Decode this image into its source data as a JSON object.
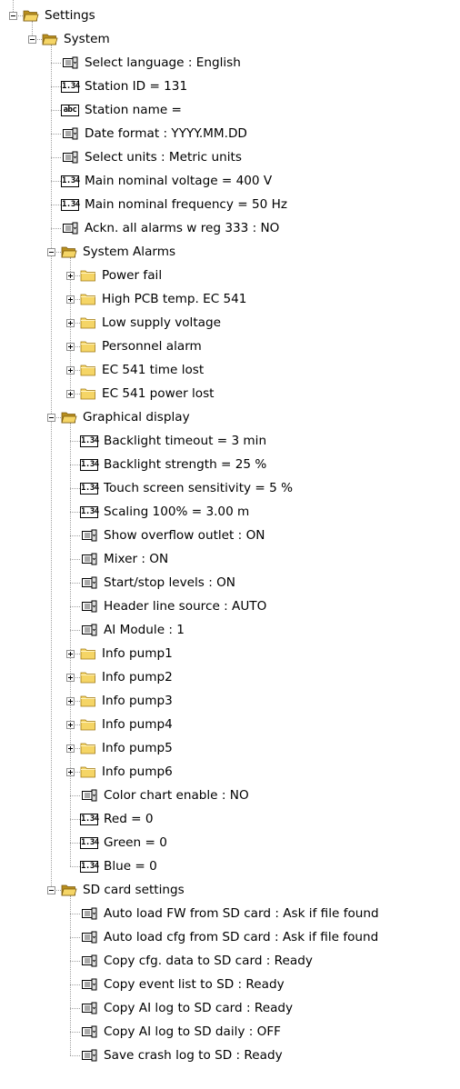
{
  "tree": [
    {
      "level": 0,
      "type": "folder-open",
      "expander": "minus",
      "label": "Settings",
      "icon": "open-folder-icon"
    },
    {
      "level": 1,
      "type": "folder-open",
      "expander": "minus",
      "label": "System",
      "icon": "open-folder-icon"
    },
    {
      "level": 2,
      "type": "enum",
      "label": "Select language : English",
      "icon": "list-select-icon"
    },
    {
      "level": 2,
      "type": "num",
      "label": "Station ID = 131",
      "icon": "numeric-value-icon",
      "badge": "1.34"
    },
    {
      "level": 2,
      "type": "abc",
      "label": "Station name =",
      "icon": "text-value-icon",
      "badge": "abc"
    },
    {
      "level": 2,
      "type": "enum",
      "label": "Date format : YYYY.MM.DD",
      "icon": "list-select-icon"
    },
    {
      "level": 2,
      "type": "enum",
      "label": "Select units : Metric units",
      "icon": "list-select-icon"
    },
    {
      "level": 2,
      "type": "num",
      "label": "Main nominal voltage = 400 V",
      "icon": "numeric-value-icon",
      "badge": "1.34"
    },
    {
      "level": 2,
      "type": "num",
      "label": "Main nominal frequency = 50 Hz",
      "icon": "numeric-value-icon",
      "badge": "1.34"
    },
    {
      "level": 2,
      "type": "enum",
      "label": "Ackn. all alarms w reg 333 : NO",
      "icon": "list-select-icon"
    },
    {
      "level": 2,
      "type": "folder-open",
      "expander": "minus",
      "label": "System Alarms",
      "icon": "open-folder-icon"
    },
    {
      "level": 3,
      "type": "folder",
      "expander": "plus",
      "label": "Power fail",
      "icon": "folder-icon"
    },
    {
      "level": 3,
      "type": "folder",
      "expander": "plus",
      "label": "High PCB temp. EC 541",
      "icon": "folder-icon"
    },
    {
      "level": 3,
      "type": "folder",
      "expander": "plus",
      "label": "Low supply voltage",
      "icon": "folder-icon"
    },
    {
      "level": 3,
      "type": "folder",
      "expander": "plus",
      "label": "Personnel alarm",
      "icon": "folder-icon"
    },
    {
      "level": 3,
      "type": "folder",
      "expander": "plus",
      "label": "EC 541 time lost",
      "icon": "folder-icon"
    },
    {
      "level": 3,
      "type": "folder",
      "expander": "plus",
      "label": "EC 541 power lost",
      "icon": "folder-icon"
    },
    {
      "level": 2,
      "type": "folder-open",
      "expander": "minus",
      "label": "Graphical display",
      "icon": "open-folder-icon"
    },
    {
      "level": 3,
      "type": "num",
      "label": "Backlight timeout = 3 min",
      "icon": "numeric-value-icon",
      "badge": "1.34"
    },
    {
      "level": 3,
      "type": "num",
      "label": "Backlight strength = 25 %",
      "icon": "numeric-value-icon",
      "badge": "1.34"
    },
    {
      "level": 3,
      "type": "num",
      "label": "Touch screen sensitivity = 5 %",
      "icon": "numeric-value-icon",
      "badge": "1.34"
    },
    {
      "level": 3,
      "type": "num",
      "label": "Scaling 100% = 3.00 m",
      "icon": "numeric-value-icon",
      "badge": "1.34"
    },
    {
      "level": 3,
      "type": "enum",
      "label": "Show overflow outlet : ON",
      "icon": "list-select-icon"
    },
    {
      "level": 3,
      "type": "enum",
      "label": "Mixer : ON",
      "icon": "list-select-icon"
    },
    {
      "level": 3,
      "type": "enum",
      "label": "Start/stop levels : ON",
      "icon": "list-select-icon"
    },
    {
      "level": 3,
      "type": "enum",
      "label": "Header line source : AUTO",
      "icon": "list-select-icon"
    },
    {
      "level": 3,
      "type": "enum",
      "label": "AI Module : 1",
      "icon": "list-select-icon"
    },
    {
      "level": 3,
      "type": "folder",
      "expander": "plus",
      "label": "Info pump1",
      "icon": "folder-icon"
    },
    {
      "level": 3,
      "type": "folder",
      "expander": "plus",
      "label": "Info pump2",
      "icon": "folder-icon"
    },
    {
      "level": 3,
      "type": "folder",
      "expander": "plus",
      "label": "Info pump3",
      "icon": "folder-icon"
    },
    {
      "level": 3,
      "type": "folder",
      "expander": "plus",
      "label": "Info pump4",
      "icon": "folder-icon"
    },
    {
      "level": 3,
      "type": "folder",
      "expander": "plus",
      "label": "Info pump5",
      "icon": "folder-icon"
    },
    {
      "level": 3,
      "type": "folder",
      "expander": "plus",
      "label": "Info pump6",
      "icon": "folder-icon"
    },
    {
      "level": 3,
      "type": "enum",
      "label": "Color chart enable : NO",
      "icon": "list-select-icon"
    },
    {
      "level": 3,
      "type": "num",
      "label": "Red = 0",
      "icon": "numeric-value-icon",
      "badge": "1.34"
    },
    {
      "level": 3,
      "type": "num",
      "label": "Green = 0",
      "icon": "numeric-value-icon",
      "badge": "1.34"
    },
    {
      "level": 3,
      "type": "num",
      "label": "Blue = 0",
      "icon": "numeric-value-icon",
      "badge": "1.34"
    },
    {
      "level": 2,
      "type": "folder-open",
      "expander": "minus",
      "label": "SD card settings",
      "icon": "open-folder-icon"
    },
    {
      "level": 3,
      "type": "enum",
      "label": "Auto load FW from SD card : Ask if file found",
      "icon": "list-select-icon"
    },
    {
      "level": 3,
      "type": "enum",
      "label": "Auto load cfg from SD card : Ask if file found",
      "icon": "list-select-icon"
    },
    {
      "level": 3,
      "type": "enum",
      "label": "Copy cfg. data to SD card : Ready",
      "icon": "list-select-icon"
    },
    {
      "level": 3,
      "type": "enum",
      "label": "Copy event list to SD : Ready",
      "icon": "list-select-icon"
    },
    {
      "level": 3,
      "type": "enum",
      "label": "Copy AI log to SD card : Ready",
      "icon": "list-select-icon"
    },
    {
      "level": 3,
      "type": "enum",
      "label": "Copy AI log to SD daily : OFF",
      "icon": "list-select-icon"
    },
    {
      "level": 3,
      "type": "enum",
      "label": "Save crash log to SD : Ready",
      "icon": "list-select-icon"
    }
  ],
  "colors": {
    "folder_fill": "#f5d566",
    "folder_dark": "#b98f1e",
    "tree_line": "#a0a0a0",
    "expander_border": "#919191"
  }
}
